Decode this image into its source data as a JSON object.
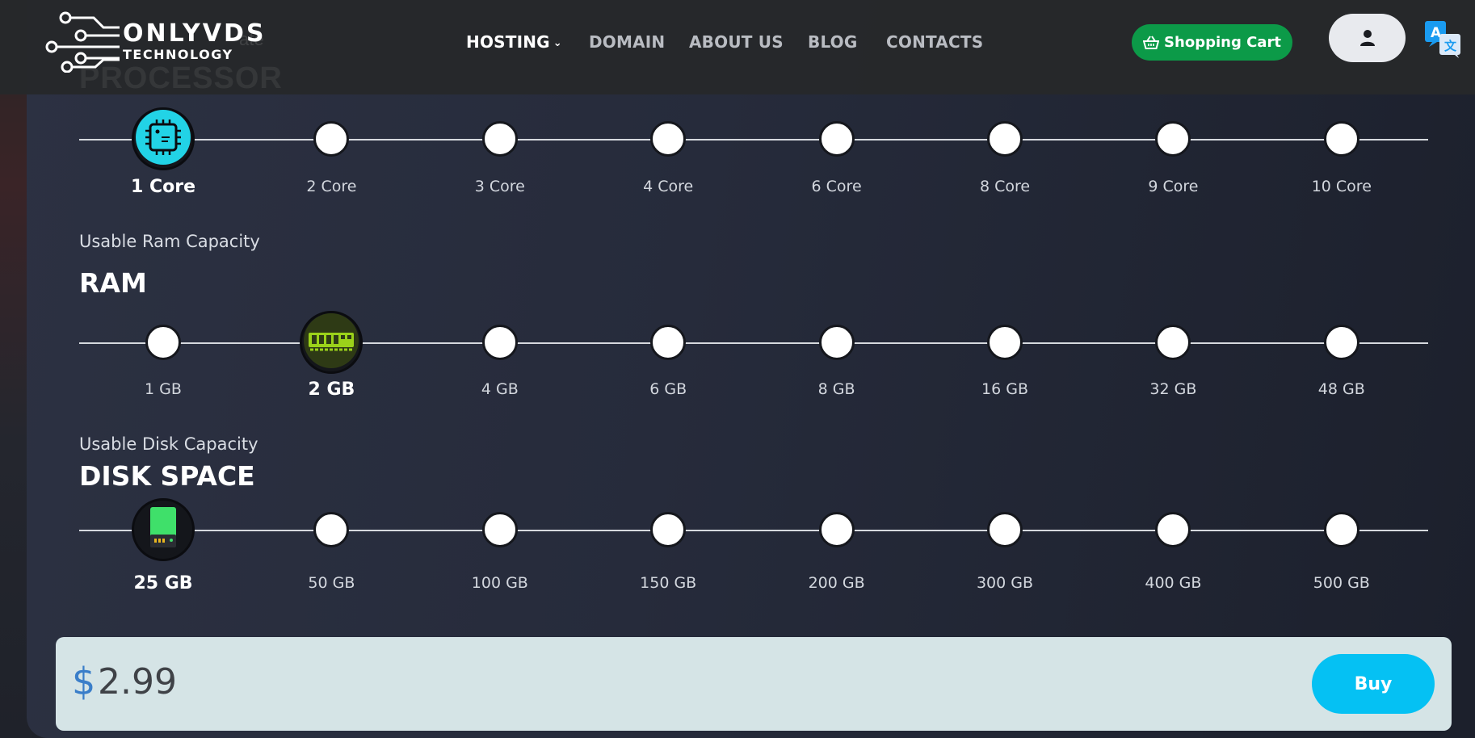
{
  "brand": {
    "name_line1": "ONLYVDS",
    "name_line2": "TECHNOLOGY"
  },
  "ghost": {
    "title": "PROCESSOR",
    "subtitle": "ate"
  },
  "nav": {
    "items": [
      {
        "label": "HOSTING",
        "active": true,
        "has_dropdown": true
      },
      {
        "label": "DOMAIN",
        "active": false
      },
      {
        "label": "ABOUT US",
        "active": false
      },
      {
        "label": "BLOG",
        "active": false
      },
      {
        "label": "CONTACTS",
        "active": false
      }
    ]
  },
  "header": {
    "cart_label": "Shopping Cart",
    "cart_icon": "basket-icon",
    "user_icon": "user-icon",
    "translate_icon": "translate-icon"
  },
  "colors": {
    "cart": "#0c9a48",
    "buy": "#05c1f3",
    "cpu_accent": "#22d3e6",
    "ram_accent": "#9bd21a",
    "disk_accent": "#3fe06a",
    "currency": "#3a7ec9"
  },
  "processor": {
    "options": [
      "1 Core",
      "2 Core",
      "3 Core",
      "4 Core",
      "6 Core",
      "8 Core",
      "9 Core",
      "10 Core"
    ],
    "selected_index": 0,
    "selected_icon": "cpu-chip-icon"
  },
  "ram": {
    "caption": "Usable Ram Capacity",
    "title": "RAM",
    "options": [
      "1 GB",
      "2 GB",
      "4 GB",
      "6 GB",
      "8 GB",
      "16 GB",
      "32 GB",
      "48 GB"
    ],
    "selected_index": 1,
    "selected_icon": "ram-module-icon"
  },
  "disk": {
    "caption": "Usable Disk Capacity",
    "title": "DISK SPACE",
    "options": [
      "25 GB",
      "50 GB",
      "100 GB",
      "150 GB",
      "200 GB",
      "300 GB",
      "400 GB",
      "500 GB"
    ],
    "selected_index": 0,
    "selected_icon": "disk-drive-icon"
  },
  "price": {
    "currency": "$",
    "amount": "2.99",
    "buy_label": "Buy"
  }
}
